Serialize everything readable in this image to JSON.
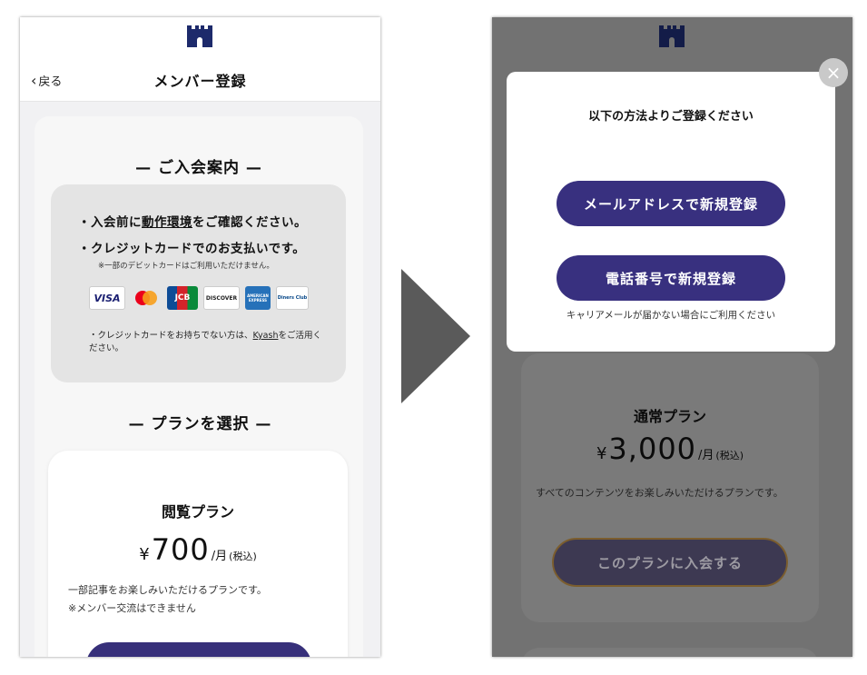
{
  "left": {
    "back_label": "戻る",
    "page_title": "メンバー登録",
    "section_info_title": "— ご入会案内 —",
    "info_line1_prefix": "・入会前に",
    "info_line1_link": "動作環境",
    "info_line1_suffix": "をご確認ください。",
    "info_line2": "・クレジットカードでのお支払いです。",
    "info_note": "※一部のデビットカードはご利用いただけません。",
    "card_brands": [
      "VISA",
      "Mastercard",
      "JCB",
      "DISCOVER",
      "AMERICAN EXPRESS",
      "Diners Club"
    ],
    "info_small_prefix": "・クレジットカードをお持ちでない方は、",
    "info_small_link": "Kyash",
    "info_small_suffix": "をご活用ください。",
    "section_plan_title": "— プランを選択 —",
    "plan": {
      "name": "閲覧プラン",
      "yen": "¥",
      "price": "700",
      "unit": "/月",
      "tax": "(税込)",
      "desc1": "一部記事をお楽しみいただけるプランです。",
      "desc2": "※メンバー交流はできません"
    }
  },
  "right": {
    "modal_title": "以下の方法よりご登録ください",
    "btn_email": "メールアドレスで新規登録",
    "btn_phone": "電話番号で新規登録",
    "modal_note": "キャリアメールが届かない場合にご利用ください",
    "close_icon": "×",
    "plan": {
      "name": "通常プラン",
      "yen": "¥",
      "price": "3,000",
      "unit": "/月",
      "tax": "(税込)",
      "desc": "すべてのコンテンツをお楽しみいただけるプランです。",
      "join_label": "このプランに入会する"
    }
  },
  "colors": {
    "brand_navy": "#37307a",
    "arrow_gray": "#5a5a5a",
    "gold_border": "#b58a44"
  },
  "icons": [
    "castle-logo-icon",
    "chevron-left-icon",
    "close-icon",
    "arrow-right-icon"
  ]
}
